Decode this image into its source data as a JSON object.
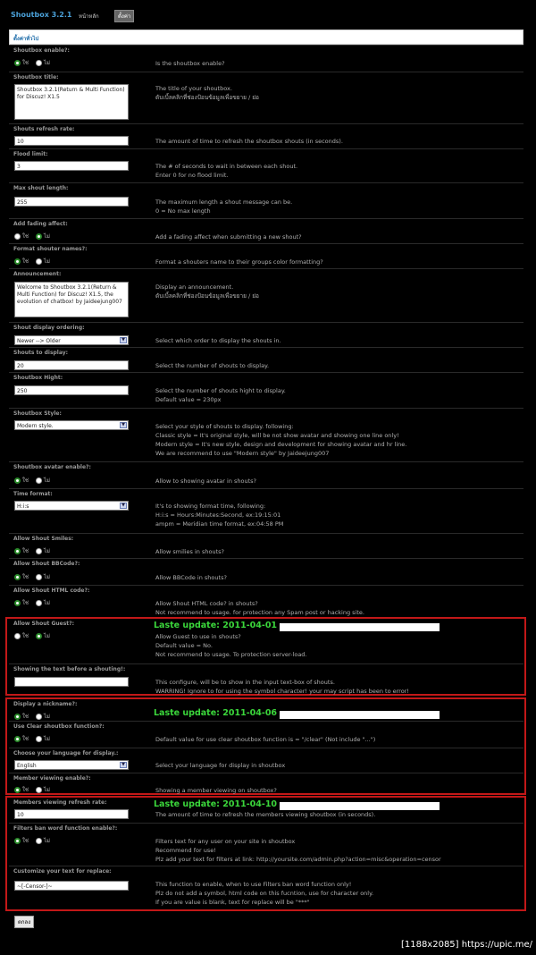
{
  "header": {
    "title": "Shoutbox 3.2.1",
    "home_link": "หน้าหลัก",
    "settings_button": "ตั้งค่า"
  },
  "panel_title": "ตั้งค่าทั่วไป",
  "radio": {
    "yes": "ใช่",
    "no": "ไม่"
  },
  "settings": {
    "enable": {
      "label": "Shoutbox enable?:",
      "d1": "Is the shoutbox enable?"
    },
    "title": {
      "label": "Shoutbox title:",
      "value": "Shoutbox 3.2.1(Return & Multi Function) for Discuz! X1.5",
      "d1": "The title of your shoutbox.",
      "d2": "ดับเบิ้ลคลิกที่ช่องป้อนข้อมูลเพื่อขยาย / ย่อ"
    },
    "refresh": {
      "label": "Shouts refresh rate:",
      "value": "10",
      "d1": "The amount of time to refresh the shoutbox shouts (in seconds)."
    },
    "flood": {
      "label": "Flood limit:",
      "value": "3",
      "d1": "The # of seconds to wait in between each shout.",
      "d2": "Enter 0 for no flood limit."
    },
    "maxlen": {
      "label": "Max shout length:",
      "value": "255",
      "d1": "The maximum length a shout message can be.",
      "d2": "0 = No max length"
    },
    "fading": {
      "label": "Add fading affect:",
      "d1": "Add a fading affect when submitting a new shout?"
    },
    "format_names": {
      "label": "Format shouter names?:",
      "d1": "Format a shouters name to their groups color formatting?"
    },
    "announcement": {
      "label": "Announcement:",
      "value": "Welcome to Shoutbox 3.2.1(Return & Multi Function) for Discuz! X1.5, the evolution of chatbox! by Jaideejung007",
      "d1": "Display an announcement.",
      "d2": "ดับเบิ้ลคลิกที่ช่องป้อนข้อมูลเพื่อขยาย / ย่อ"
    },
    "ordering": {
      "label": "Shout display ordering:",
      "value": "Newer --> Older",
      "d1": "Select which order to display the shouts in."
    },
    "to_display": {
      "label": "Shouts to display:",
      "value": "20",
      "d1": "Select the number of shouts to display."
    },
    "hight": {
      "label": "Shoutbox Hight:",
      "value": "250",
      "d1": "Select the number of shouts hight to display.",
      "d2": "Default value = 230px"
    },
    "style": {
      "label": "Shoutbox Style:",
      "value": "Modern style.",
      "d1": "Select your style of shouts to display. following:",
      "d2": "Classic style = It's original style, will be not show avatar and showing one line only!",
      "d3": "Modern style = It's new style, design and development for showing avatar and hr line.",
      "d4": "We are recommend to use \"Modern style\" by Jaideejung007"
    },
    "avatar": {
      "label": "Shoutbox avatar enable?:",
      "d1": "Allow to showing avatar in shouts?"
    },
    "time_format": {
      "label": "Time format:",
      "value": "H:i:s",
      "d1": "It's to showing format time, following:",
      "d2": "H:i:s = Hours:Minutes:Second, ex:19:15:01",
      "d3": "ampm = Meridian time format, ex:04:58 PM"
    },
    "smiles": {
      "label": "Allow Shout Smiles:",
      "d1": "Allow smilies in shouts?"
    },
    "bbcode": {
      "label": "Allow Shout BBCode?:",
      "d1": "Allow BBCode in shouts?"
    },
    "html": {
      "label": "Allow Shout HTML code?:",
      "d1": "Allow Shout HTML code? in shouts?",
      "d2": "Not recommend to usage. for protection any Spam post or hacking site."
    },
    "guest": {
      "label": "Allow Shout Guest?:",
      "update": "Laste update: 2011-04-01",
      "d1": "Allow Guest to use in shouts?",
      "d2": "Default value = No.",
      "d3": "Not recommend to usage. To protection server-load."
    },
    "before_text": {
      "label": "Showing the text before a shouting!:",
      "value": "",
      "d1": "This configure, will be to show in the input text-box of shouts.",
      "d2": "WARRING! Ignore to for using the symbol character! your may script has been to error!"
    },
    "nickname": {
      "label": "Display a nickname?:",
      "update": "Laste update: 2011-04-06"
    },
    "clear": {
      "label": "Use Clear shoutbox function?:",
      "d1": "Default value for use clear shoutbox function is = \"/clear\" (Not include \"...\")"
    },
    "language": {
      "label": "Choose your language for display.:",
      "value": "English",
      "d1": "Select your language for display in shoutbox"
    },
    "member_view": {
      "label": "Member viewing enable?:",
      "d1": "Showing a member viewing on shoutbox?"
    },
    "member_refresh": {
      "label": "Members viewing refresh rate:",
      "update": "Laste update: 2011-04-10",
      "value": "10",
      "d1": "The amount of time to refresh the members viewing shoutbox (in seconds)."
    },
    "ban_word": {
      "label": "Filters ban word function enable?:",
      "d1": "Filters text for any user on your site in shoutbox",
      "d2": "Recommend for use!",
      "d3": "Plz add your text for filters at link: http://yoursite.com/admin.php?action=misc&operation=censor"
    },
    "replace": {
      "label": "Customize your text for replace:",
      "value": "~[-Censor-]~",
      "d1": "This function to enable, when to use Filters ban word function only!",
      "d2": "Plz do not add a symbol, html code on this fucntion, use for character only.",
      "d3": "If you are value is blank, text for replace will be \"***\""
    }
  },
  "submit_label": "ตกลง",
  "watermark": "[1188x2085] https://upic.me/"
}
